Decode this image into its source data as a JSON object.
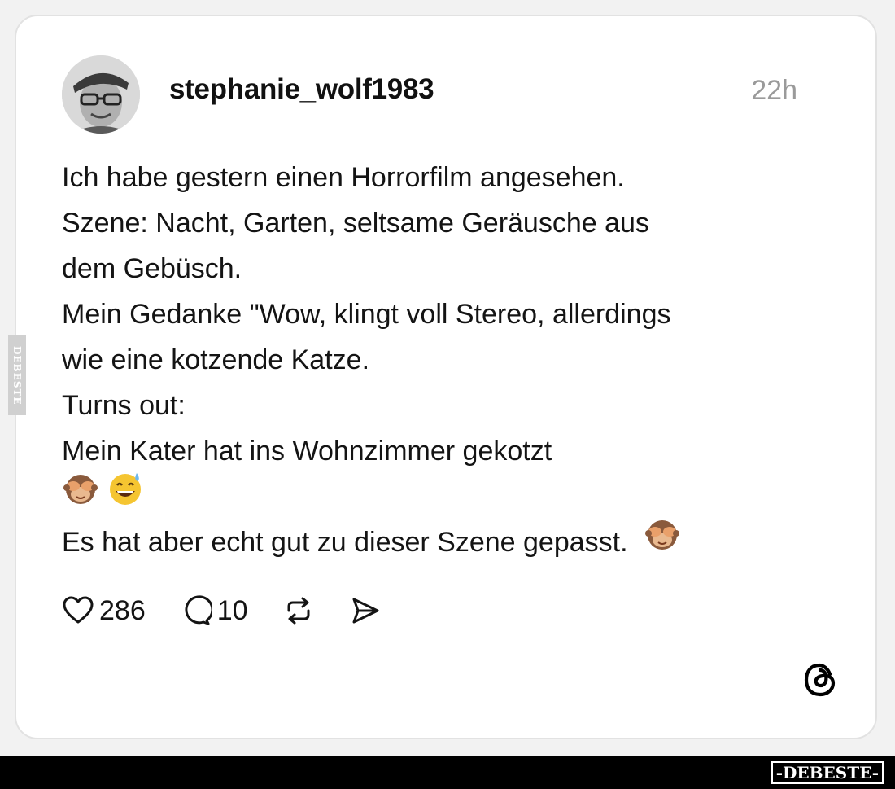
{
  "post": {
    "username": "stephanie_wolf1983",
    "timestamp": "22h",
    "lines": [
      "Ich habe gestern einen Horrorfilm angesehen.",
      "Szene: Nacht, Garten, seltsame Geräusche aus",
      "dem Gebüsch.",
      "Mein Gedanke \"Wow, klingt voll Stereo, allerdings",
      "wie eine kotzende Katze.",
      "Turns out:",
      "Mein Kater hat ins Wohnzimmer gekotzt",
      "",
      "Es hat aber echt gut zu dieser Szene gepasst."
    ],
    "emojis": [
      "see-no-evil-monkey",
      "grinning-face-with-sweat"
    ],
    "trailing_emoji": "see-no-evil-monkey"
  },
  "actions": {
    "like_count": "286",
    "comment_count": "10",
    "icons": [
      "heart-icon",
      "comment-icon",
      "repost-icon",
      "share-icon"
    ]
  },
  "branding": {
    "app_logo": "threads-logo-icon",
    "watermark_side": "DEBESTE",
    "watermark_bottom": "-DEBESTE-"
  },
  "colors": {
    "text": "#141414",
    "muted": "#9a9a9a",
    "card_border": "#e2e2e2"
  }
}
